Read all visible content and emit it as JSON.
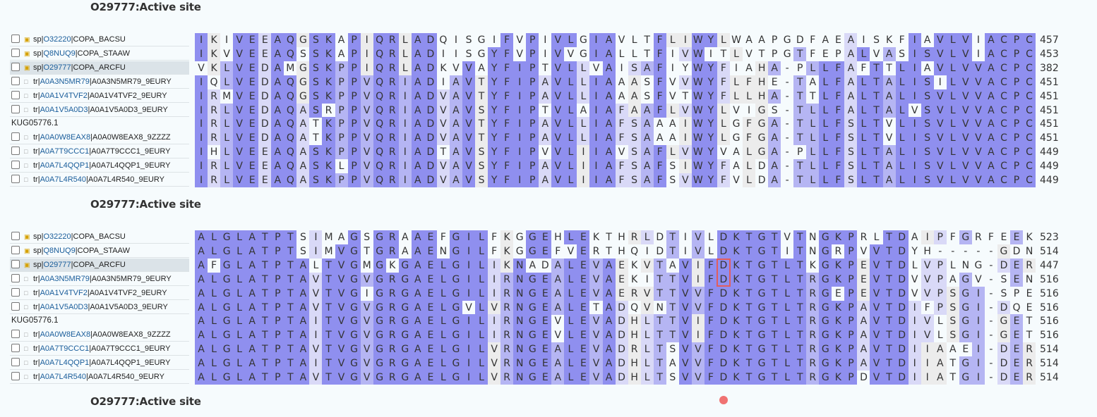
{
  "feature_label": "O29777:Active site",
  "colors": {
    "identity_high": "#8f8fef",
    "identity_mid": "#b5b5f3",
    "identity_low": "#d9d9f7",
    "gap_light": "#ececec",
    "active_site": "#e25d5d"
  },
  "active_site": {
    "block": 1,
    "column": 41
  },
  "blocks": [
    {
      "rows": [
        {
          "prefix": "sp|",
          "acc": "O32220",
          "suffix": "|COPA_BACSU",
          "icon": "sp-icon",
          "selected": false,
          "seq": "IKIVEEAQGSKAPIQRLADQISGIFVPIVLGIAVLTFLIWYLWAAPGDFAEAISKFIAVLVIACPC",
          "end": "457"
        },
        {
          "prefix": "sp|",
          "acc": "Q8NUQ9",
          "suffix": "|COPA_STAAW",
          "icon": "sp-icon",
          "selected": false,
          "seq": "IKVVEEAQSSKAPIQRLADIISGYFVPIVVGIALLTFIVWITLVTPGTFEPALVASISVLVIACPC",
          "end": "453"
        },
        {
          "prefix": "sp|",
          "acc": "O29777",
          "suffix": "|COPA_ARCFU",
          "icon": "sp-icon",
          "selected": true,
          "seq": "VKLVEDAMGSKPPIQRLADKVVAYFIPTVLLVAISAFIYWYFIAHA-PLLFAFTTLIAVLVVACPC",
          "end": "382"
        },
        {
          "prefix": "tr|",
          "acc": "A0A3N5MR79",
          "suffix": "|A0A3N5MR79_9EURY",
          "icon": "tr-icon",
          "selected": false,
          "seq": "IQLVEDAQGSKPPVQRIADIAVTYFIPAVLLIAAASFVVWYFLFHE-TALFALTALISILVVACPC",
          "end": "451"
        },
        {
          "prefix": "tr|",
          "acc": "A0A1V4TVF2",
          "suffix": "|A0A1V4TVF2_9EURY",
          "icon": "tr-icon",
          "selected": false,
          "seq": "IRMVEDAQGSKPPVQRIADVAVTYFIPAVLLIAAASFVTWYFLLHA-TTLFALTALISVLVVACPC",
          "end": "451"
        },
        {
          "prefix": "tr|",
          "acc": "A0A1V5A0D3",
          "suffix": "|A0A1V5A0D3_9EURY",
          "icon": "tr-icon",
          "selected": false,
          "seq": "IRLVEDAQASRPPVQRIADVAVSYFIPTVLAIAFAAFLVWYLVIGS-TLLFALTALVSVLVVACPC",
          "end": "451"
        },
        {
          "plain": "KUG05776.1",
          "selected": false,
          "seq": "IRLVEDAQATKPPVQRIADVAVTYFIPAVLLIAFSAAAIWYLGFGA-TLLFSLTVLISVLVVACPC",
          "end": "451"
        },
        {
          "prefix": "tr|",
          "acc": "A0A0W8EAX8",
          "suffix": "|A0A0W8EAX8_9ZZZZ",
          "icon": "tr-icon",
          "selected": false,
          "seq": "IRLVEDAQATKPPVQRIADVAVTYFIPAVLLIAFSAAAIWYLGFGA-TLLFSLTVLISVLVVACPC",
          "end": "451"
        },
        {
          "prefix": "tr|",
          "acc": "A0A7T9CCC1",
          "suffix": "|A0A7T9CCC1_9EURY",
          "icon": "tr-icon",
          "selected": false,
          "seq": "IHLVEEAQASKPPVQRIADTAVSYFIPVVLIIAVSAFLVWYVALGA-PLLFSLTALISVLVVACPC",
          "end": "449"
        },
        {
          "prefix": "tr|",
          "acc": "A0A7L4QQP1",
          "suffix": "|A0A7L4QQP1_9EURY",
          "icon": "tr-icon",
          "selected": false,
          "seq": "IRLVEEAQASKLPVQRIADVAVSYFIPAVLIIAFSAFSIWYFALDA-TLLFSLTALISVLVVACPC",
          "end": "449"
        },
        {
          "prefix": "tr|",
          "acc": "A0A7L4R540",
          "suffix": "|A0A7L4R540_9EURY",
          "icon": "tr-icon",
          "selected": false,
          "seq": "IRLVEEAQASKPPVQRIADVAVSYFIPAVLIIAFSAFSVWYFVLDA-TLLFSLTALISVLVVACPC",
          "end": "449"
        }
      ]
    },
    {
      "rows": [
        {
          "prefix": "sp|",
          "acc": "O32220",
          "suffix": "|COPA_BACSU",
          "icon": "sp-icon",
          "selected": false,
          "seq": "ALGLATPTSIMAGSGRAAEFGILFKGGEHLEKTHRLDTIVLDKTGTVTNGKPRLTDAIPFGRFEEK",
          "end": "523"
        },
        {
          "prefix": "sp|",
          "acc": "Q8NUQ9",
          "suffix": "|COPA_STAAW",
          "icon": "sp-icon",
          "selected": false,
          "seq": "ALGLATPTSIMVGTGRAAENGILFKGGEFVERTHQIDTIVLDKTGTITNGRPVVTDYH-----GDN",
          "end": "514"
        },
        {
          "prefix": "sp|",
          "acc": "O29777",
          "suffix": "|COPA_ARCFU",
          "icon": "sp-icon",
          "selected": true,
          "seq": "AFGLATPTALTVGMGKGAELGILIKNADALEVAEKVTAVIFDKTGTLTKGKPEVTDLVPLNG-DER",
          "end": "447"
        },
        {
          "prefix": "tr|",
          "acc": "A0A3N5MR79",
          "suffix": "|A0A3N5MR79_9EURY",
          "icon": "tr-icon",
          "selected": false,
          "seq": "ALGLATPTAVTVGVGRGAELGILIRNGEALEVAEKITTVIFDKTGTLTRGKPEVTDVVPAGV-SEN",
          "end": "516"
        },
        {
          "prefix": "tr|",
          "acc": "A0A1V4TVF2",
          "suffix": "|A0A1V4TVF2_9EURY",
          "icon": "tr-icon",
          "selected": false,
          "seq": "ALGLATPTAVTVGIGRGAELGILIRNGEALEVAERVTTVVFDKTGTLTRGEPEVTDVVPSGI-SPE",
          "end": "516"
        },
        {
          "prefix": "tr|",
          "acc": "A0A1V5A0D3",
          "suffix": "|A0A1V5A0D3_9EURY",
          "icon": "tr-icon",
          "selected": false,
          "seq": "ALGLATPTAVTVGVGRGAELGVLVRNGEALETADQVNTVVFDKTGTLTRGKPAVTDIFPSGI-DQE",
          "end": "516"
        },
        {
          "plain": "KUG05776.1",
          "selected": false,
          "seq": "ALGLATPTAITVGVGRGAELGILIRNGEVLEVADHLTTVIFDKTGTLTRGKPAVTDIVLSGI-GET",
          "end": "516"
        },
        {
          "prefix": "tr|",
          "acc": "A0A0W8EAX8",
          "suffix": "|A0A0W8EAX8_9ZZZZ",
          "icon": "tr-icon",
          "selected": false,
          "seq": "ALGLATPTAITVGVGRGAELGILIRNGEVLEVADHLTTVIFDKTGTLTRGKPAVTDIVLSGI-GET",
          "end": "516"
        },
        {
          "prefix": "tr|",
          "acc": "A0A7T9CCC1",
          "suffix": "|A0A7T9CCC1_9EURY",
          "icon": "tr-icon",
          "selected": false,
          "seq": "ALGLATPTAVTVGVGRGAELGILVRNGEALEVADRLTSVVFDKTGTLTRGKPAVTDIIAAEI-DER",
          "end": "514"
        },
        {
          "prefix": "tr|",
          "acc": "A0A7L4QQP1",
          "suffix": "|A0A7L4QQP1_9EURY",
          "icon": "tr-icon",
          "selected": false,
          "seq": "ALGLATPTAITVGVGRGAELGILVRNGEALEVADHLTAVVFDKTGTLTRGKPAVTDIIATGI-DER",
          "end": "514"
        },
        {
          "prefix": "tr|",
          "acc": "A0A7L4R540",
          "suffix": "|A0A7L4R540_9EURY",
          "icon": "tr-icon",
          "selected": false,
          "seq": "ALGLATPTAVTVGVGRGAELGILVRNGEALEVADHLTSVVFDKTGTLTRGKPDVTDIIATGI-DER",
          "end": "514"
        }
      ]
    }
  ]
}
